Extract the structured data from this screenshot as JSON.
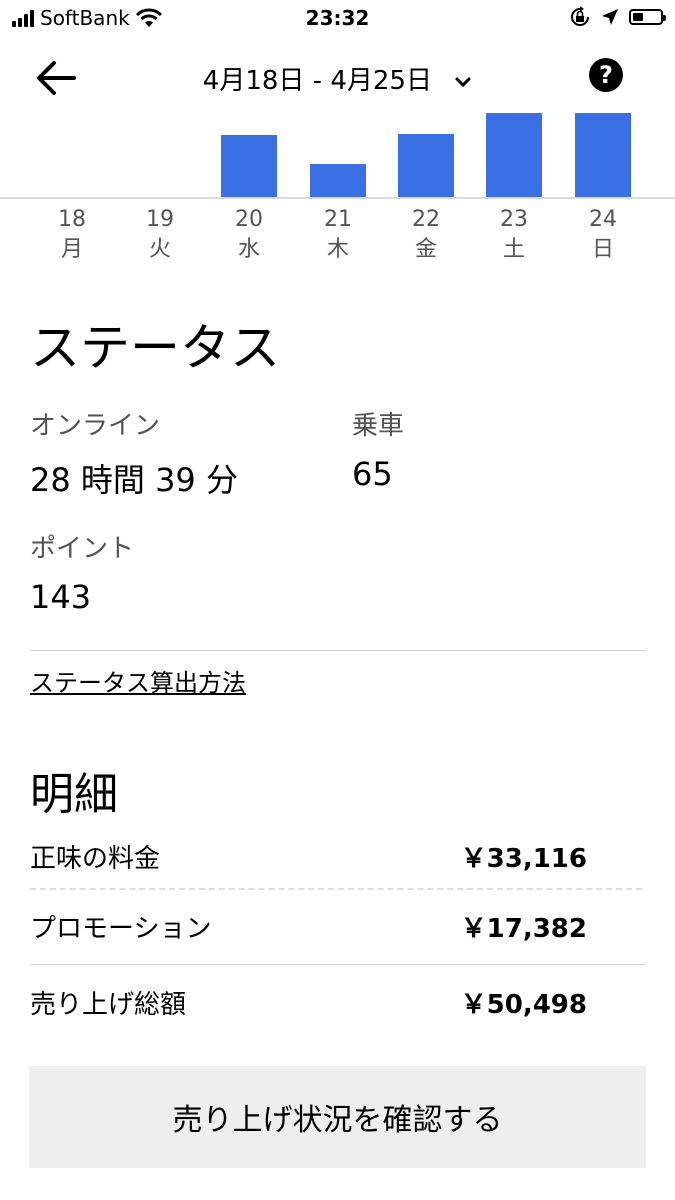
{
  "status_bar": {
    "carrier": "SoftBank",
    "time": "23:32",
    "icons": [
      "signal-icon",
      "wifi-icon",
      "rotation-lock-icon",
      "location-icon",
      "battery-icon"
    ]
  },
  "header": {
    "date_range": "4月18日 - 4月25日",
    "icons": {
      "back": "arrow-left-icon",
      "dropdown": "chevron-down-icon",
      "help": "help-icon"
    }
  },
  "chart_data": {
    "type": "bar",
    "categories": [
      "18 月",
      "19 火",
      "20 水",
      "21 木",
      "22 金",
      "23 土",
      "24 日"
    ],
    "days": [
      {
        "num": "18",
        "weekday": "月"
      },
      {
        "num": "19",
        "weekday": "火"
      },
      {
        "num": "20",
        "weekday": "水"
      },
      {
        "num": "21",
        "weekday": "木"
      },
      {
        "num": "22",
        "weekday": "金"
      },
      {
        "num": "23",
        "weekday": "土"
      },
      {
        "num": "24",
        "weekday": "日"
      }
    ],
    "values": [
      0,
      0,
      0.74,
      0.39,
      0.75,
      1.0,
      1.0
    ],
    "unit": "relative",
    "bar_color": "#3b6fe4",
    "grid": false
  },
  "status": {
    "title": "ステータス",
    "online_label": "オンライン",
    "online_value": "28 時間 39 分",
    "rides_label": "乗車",
    "rides_value": "65",
    "points_label": "ポイント",
    "points_value": "143",
    "method_link": "ステータス算出方法"
  },
  "breakdown": {
    "title": "明細",
    "rows": [
      {
        "label": "正味の料金",
        "amount": "￥33,116"
      },
      {
        "label": "プロモーション",
        "amount": "￥17,382"
      },
      {
        "label": "売り上げ総額",
        "amount": "￥50,498"
      }
    ]
  },
  "cta": {
    "label": "売り上げ状況を確認する"
  }
}
